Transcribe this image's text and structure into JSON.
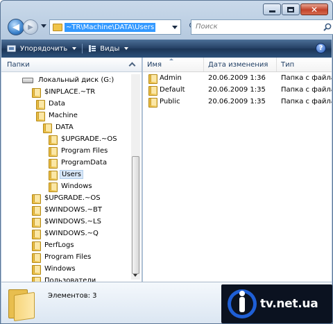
{
  "address": {
    "path": "~TR\\Machine\\DATA\\Users"
  },
  "search": {
    "placeholder": "Поиск"
  },
  "toolbar": {
    "organize_label": "Упорядочить",
    "views_label": "Виды"
  },
  "left_pane": {
    "header": "Папки",
    "tree": [
      {
        "label": "Локальный диск (G:)",
        "icon": "drive-icon",
        "depth": 0
      },
      {
        "label": "$INPLACE.~TR",
        "icon": "folder-icon",
        "depth": 1
      },
      {
        "label": "Data",
        "icon": "folder-icon",
        "depth": 2
      },
      {
        "label": "Machine",
        "icon": "folder-icon",
        "depth": 2
      },
      {
        "label": "DATA",
        "icon": "folder-icon",
        "depth": 3
      },
      {
        "label": "$UPGRADE.~OS",
        "icon": "folder-icon",
        "depth": 4
      },
      {
        "label": "Program Files",
        "icon": "folder-icon",
        "depth": 4
      },
      {
        "label": "ProgramData",
        "icon": "folder-icon",
        "depth": 4
      },
      {
        "label": "Users",
        "icon": "folder-icon",
        "depth": 4,
        "selected": true
      },
      {
        "label": "Windows",
        "icon": "folder-icon",
        "depth": 4
      },
      {
        "label": "$UPGRADE.~OS",
        "icon": "folder-icon",
        "depth": 1
      },
      {
        "label": "$WINDOWS.~BT",
        "icon": "folder-icon",
        "depth": 1
      },
      {
        "label": "$WINDOWS.~LS",
        "icon": "folder-icon",
        "depth": 1
      },
      {
        "label": "$WINDOWS.~Q",
        "icon": "folder-icon",
        "depth": 1
      },
      {
        "label": "PerfLogs",
        "icon": "folder-icon",
        "depth": 1
      },
      {
        "label": "Program Files",
        "icon": "folder-icon",
        "depth": 1
      },
      {
        "label": "Windows",
        "icon": "folder-icon",
        "depth": 1
      },
      {
        "label": "Пользователи",
        "icon": "folder-icon",
        "depth": 1
      }
    ]
  },
  "file_list": {
    "columns": {
      "name": "Имя",
      "date": "Дата изменения",
      "type": "Тип"
    },
    "rows": [
      {
        "name": "Admin",
        "date": "20.06.2009 1:36",
        "type": "Папка с файлами"
      },
      {
        "name": "Default",
        "date": "20.06.2009 1:35",
        "type": "Папка с файлами"
      },
      {
        "name": "Public",
        "date": "20.06.2009 1:35",
        "type": "Папка с файлами"
      }
    ]
  },
  "details": {
    "count": "Элементов: 3"
  },
  "watermark": {
    "text": "tv.net.ua"
  },
  "colors": {
    "toolbar": "#243f63",
    "selection": "#3399ff",
    "folder": "#e7b83c"
  }
}
